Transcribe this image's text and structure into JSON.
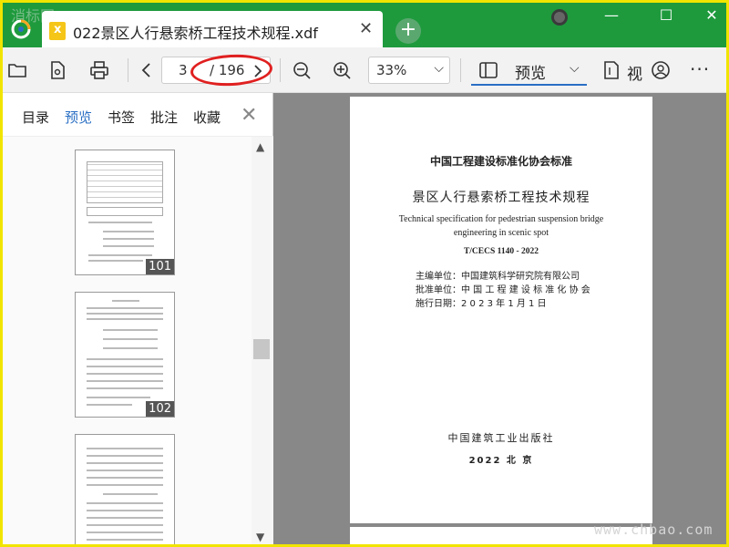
{
  "watermark_top": "消标网",
  "watermark_bottom": "www.chbao.com",
  "tab": {
    "title": "022景区人行悬索桥工程技术规程.xdf",
    "close": "✕"
  },
  "titlebar": {
    "new_tab": "+",
    "minimize": "—",
    "maximize": "☐",
    "close": "✕"
  },
  "toolbar": {
    "page_current": "3",
    "page_total": "/ 196",
    "zoom": "33%",
    "mode": "预览",
    "view_label": "视",
    "more": "···"
  },
  "sidebar": {
    "tabs": [
      "目录",
      "预览",
      "书签",
      "批注",
      "收藏"
    ],
    "active_tab": "预览",
    "close": "✕",
    "thumbnails": [
      "101",
      "102"
    ]
  },
  "document": {
    "org": "中国工程建设标准化协会标准",
    "title": "景区人行悬索桥工程技术规程",
    "title_en_1": "Technical specification for pedestrian suspension bridge",
    "title_en_2": "engineering in scenic spot",
    "code": "T/CECS 1140 - 2022",
    "editor": "主编单位：中国建筑科学研究院有限公司",
    "approver": "批准单位：中 国 工 程 建 设 标 准 化 协 会",
    "effective": "施行日期：2 0 2 3 年 1 月 1 日",
    "publisher": "中国建筑工业出版社",
    "year_city": "2022  北    京"
  },
  "colors": {
    "titlebar": "#1e9a3d",
    "frame": "#f1e500",
    "accent": "#2a6fc4",
    "annotation": "#e02020"
  }
}
